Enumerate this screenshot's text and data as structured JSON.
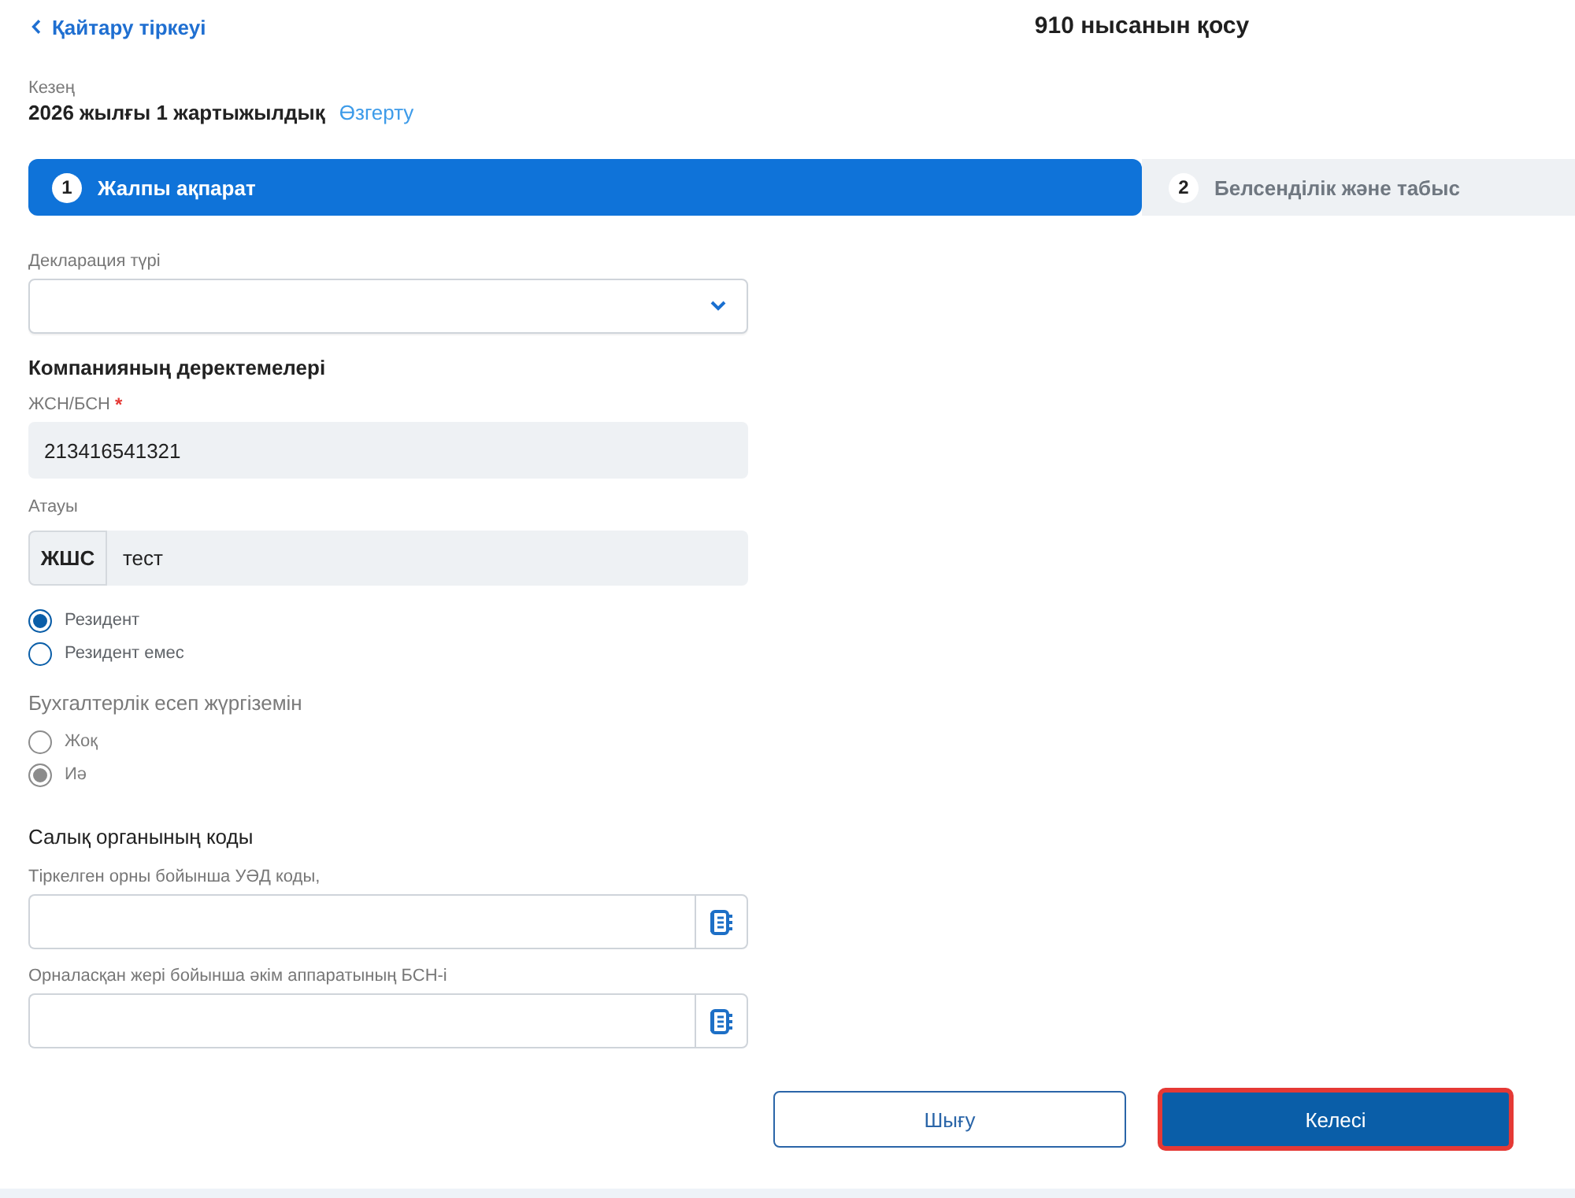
{
  "header": {
    "back_link": "Қайтару тіркеуі",
    "title": "910 нысанын қосу"
  },
  "period": {
    "label": "Кезең",
    "value": "2026 жылғы 1 жартыжылдық",
    "change_link": "Өзгерту"
  },
  "steps": [
    {
      "number": "1",
      "label": "Жалпы ақпарат",
      "selected": true
    },
    {
      "number": "2",
      "label": "Белсенділік және табыс",
      "selected": false
    }
  ],
  "form": {
    "declaration_type": {
      "label": "Декларация түрі"
    },
    "company": {
      "heading": "Компанияның деректемелері",
      "iin_bin": {
        "label": "ЖСН/БСН",
        "required_mark": "*",
        "value": "213416541321"
      },
      "name": {
        "label": "Атауы",
        "prefix": "ЖШС",
        "value": "тест"
      },
      "residency": [
        {
          "label": "Резидент",
          "selected": true,
          "disabled": false
        },
        {
          "label": "Резидент емес",
          "selected": false,
          "disabled": false
        }
      ]
    },
    "accounting": {
      "heading": "Бухгалтерлік есеп жүргіземін",
      "options": [
        {
          "label": "Жоқ",
          "selected": false,
          "disabled": true
        },
        {
          "label": "Иә",
          "selected": true,
          "disabled": true
        }
      ]
    },
    "tax_authority": {
      "heading": "Салық органының коды",
      "fields": [
        {
          "label": "Тіркелген орны бойынша УӘД коды,"
        },
        {
          "label": "Орналасқан жері бойынша әкім аппаратының БСН-і"
        }
      ]
    }
  },
  "buttons": [
    {
      "label": "Шығу",
      "kind": "secondary",
      "highlighted": false
    },
    {
      "label": "Келесі",
      "kind": "primary",
      "highlighted": true
    }
  ]
}
